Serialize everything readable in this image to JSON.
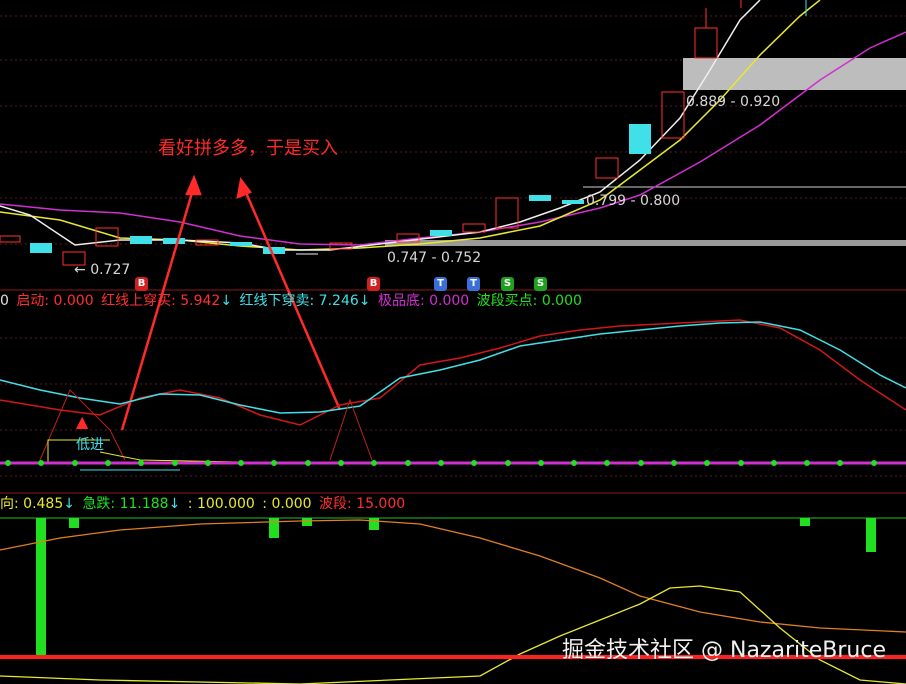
{
  "annotation": {
    "text": "看好拼多多，于是买入"
  },
  "price_labels": {
    "low": "0.727",
    "range_a": "0.747 - 0.752",
    "range_b": "0.799 - 0.800",
    "range_c": "0.889 - 0.920"
  },
  "signals": {
    "b1": "B",
    "b2": "B",
    "t1": "T",
    "t2": "T",
    "s1": "S",
    "s2": "S"
  },
  "indicator1": {
    "prefix": "0",
    "start": "启动: 0.000",
    "red_cross": "红线上穿买: 5.942",
    "red_cross_arrow": "↓",
    "red_down": "红线下穿卖: 7.246",
    "red_down_arrow": "↓",
    "bottom": "极品底: 0.000",
    "wave_buy": "波段买点: 0.000",
    "low_entry_label": "低进"
  },
  "indicator2": {
    "dir": "向: 0.485",
    "dir_arrow": "↓",
    "crash": "急跌: 11.188",
    "crash_arrow": "↓",
    "v1": ": 100.000",
    "v2": ": 0.000",
    "wave": "波段: 15.000"
  },
  "watermark": "掘金技术社区 @ NazariteBruce",
  "colors": {
    "red": "#ff2a2a",
    "cyan": "#40e0e8",
    "magenta": "#d020d0",
    "yellow": "#e8e830",
    "green": "#20e020",
    "orange": "#e08020"
  },
  "chart_data": {
    "type": "candlestick",
    "panels": [
      "price",
      "indicator1",
      "indicator2"
    ]
  }
}
